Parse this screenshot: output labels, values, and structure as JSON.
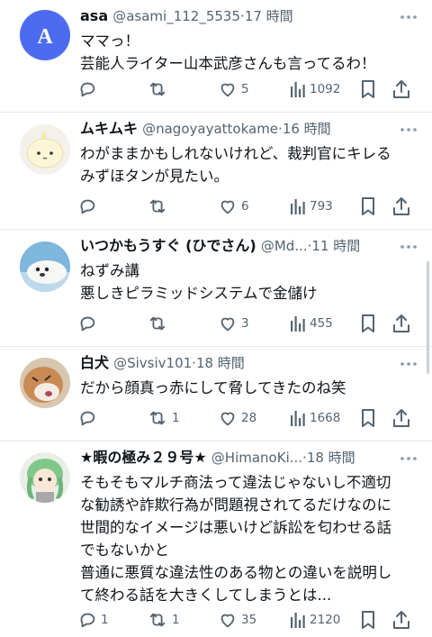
{
  "colors": {
    "text": "#0f1419",
    "muted": "#536471",
    "divider": "#e7e9ec",
    "avatar_blue": "#4c6bf0"
  },
  "tweets": [
    {
      "name": "asa",
      "handle": "@asami_112_5535",
      "separator": "·",
      "time": "17 時間",
      "avatar_letter": "A",
      "lines": [
        "ママっ！",
        "芸能人ライター山本武彦さんも言ってるわ！"
      ],
      "replies": "",
      "retweets": "",
      "likes": "5",
      "views": "1092"
    },
    {
      "name": "ムキムキ",
      "handle": "@nagoyayattokame",
      "separator": "·",
      "time": "16 時間",
      "lines": [
        "わがままかもしれないけれど、裁判官にキレる",
        "みずほタンが見たい。"
      ],
      "replies": "",
      "retweets": "",
      "likes": "6",
      "views": "793"
    },
    {
      "name": "いつかもうすぐ (ひでさん)",
      "handle": "@Md...",
      "separator": "·",
      "time": "11 時間",
      "lines": [
        "ねずみ講",
        "悪しきピラミッドシステムで金儲け"
      ],
      "replies": "",
      "retweets": "",
      "likes": "3",
      "views": "455"
    },
    {
      "name": "白犬",
      "handle": "@Sivsiv101",
      "separator": "·",
      "time": "18 時間",
      "lines": [
        "だから顔真っ赤にして脅してきたのね笑"
      ],
      "replies": "",
      "retweets": "1",
      "likes": "28",
      "views": "1668"
    },
    {
      "name": "★暇の極み２９号★",
      "handle": "@HimanoKi...",
      "separator": "·",
      "time": "18 時間",
      "lines": [
        "そもそもマルチ商法って違法じゃないし不適切",
        "な勧誘や詐欺行為が問題視されてるだけなのに",
        "世間的なイメージは悪いけど訴訟を匂わせる話",
        "でもないかと",
        "普通に悪質な違法性のある物との違いを説明し",
        "て終わる話を大きくしてしまうとは..."
      ],
      "replies": "1",
      "retweets": "1",
      "likes": "35",
      "views": "2120"
    }
  ]
}
